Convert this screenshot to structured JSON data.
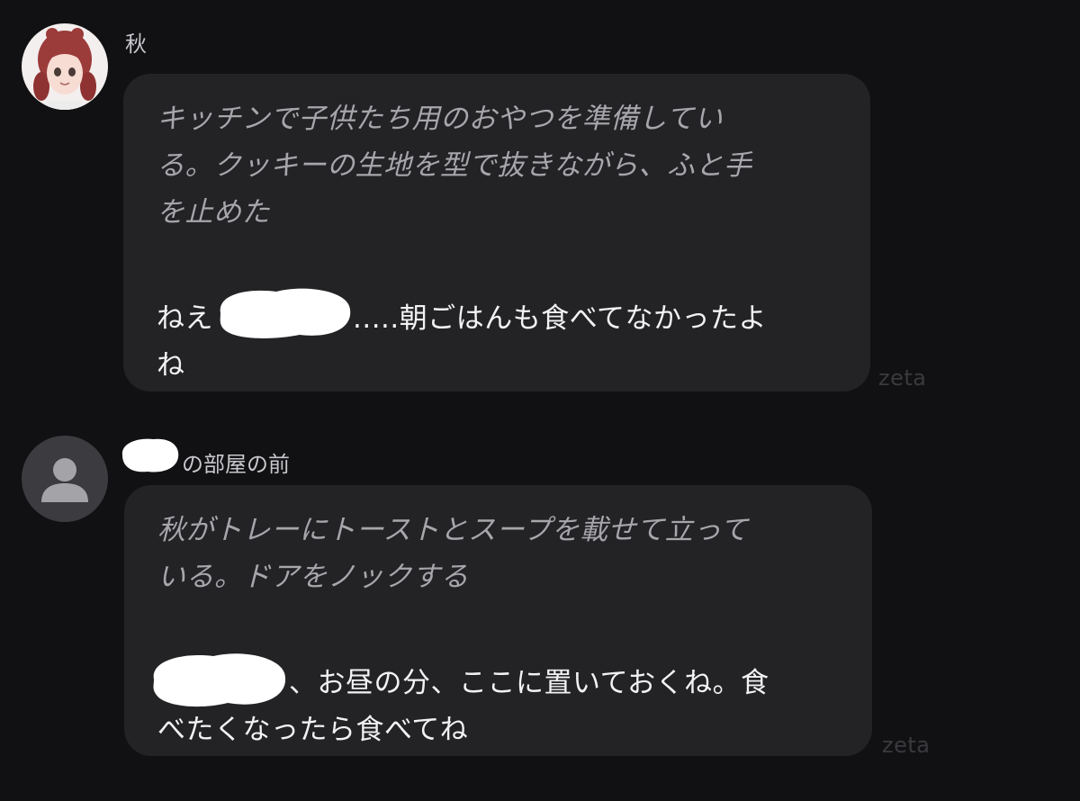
{
  "messages": [
    {
      "sender": "秋",
      "narration": [
        "キッチンで子供たち用のおやつを準備してい",
        "る。クッキーの生地を型で抜きながら、ふと手",
        "を止めた"
      ],
      "speech_before": "ねえ",
      "speech_after_line1": ".....朝ごはんも食べてなかったよ",
      "speech_line2": "ね",
      "watermark": "zeta"
    },
    {
      "sender_suffix": "の部屋の前",
      "narration": [
        "秋がトレーにトーストとスープを載せて立って",
        "いる。ドアをノックする"
      ],
      "speech_after_line1": "、お昼の分、ここに置いておくね。食",
      "speech_line2": "べたくなったら食べてね",
      "watermark": "zeta"
    }
  ],
  "colors": {
    "background": "#111113",
    "bubble": "#232326",
    "narration_text": "#a6a6ab",
    "speech_text": "#f2f2f4",
    "name_text": "#c7c7cc",
    "watermark": "#3a3a3e"
  },
  "icons": [
    "character-avatar-icon",
    "default-user-avatar-icon"
  ]
}
